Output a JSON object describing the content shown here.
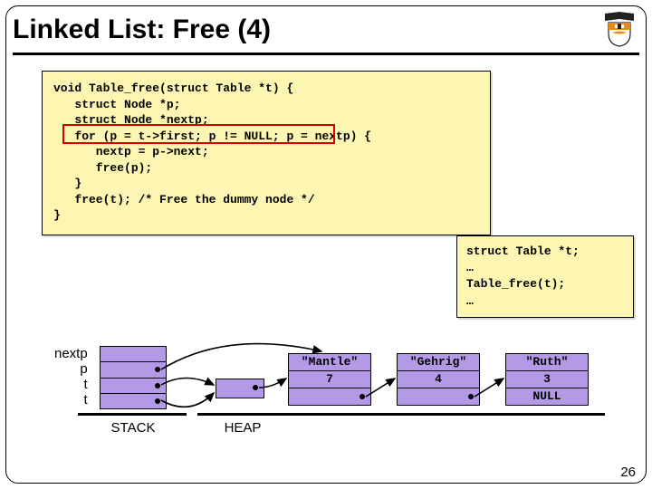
{
  "title": "Linked List: Free (4)",
  "code": "void Table_free(struct Table *t) {\n   struct Node *p;\n   struct Node *nextp;\n   for (p = t->first; p != NULL; p = nextp) {\n      nextp = p->next;\n      free(p);\n   }\n   free(t); /* Free the dummy node */\n}",
  "caller": "struct Table *t;\n…\nTable_free(t);\n…",
  "stack_labels": [
    "nextp",
    "p",
    "t",
    "t"
  ],
  "area_labels": {
    "stack": "STACK",
    "heap": "HEAP"
  },
  "nodes": [
    {
      "key": "\"Mantle\"",
      "val": "7"
    },
    {
      "key": "\"Gehrig\"",
      "val": "4"
    },
    {
      "key": "\"Ruth\"",
      "val": "3",
      "next": "NULL"
    }
  ],
  "page": "26"
}
